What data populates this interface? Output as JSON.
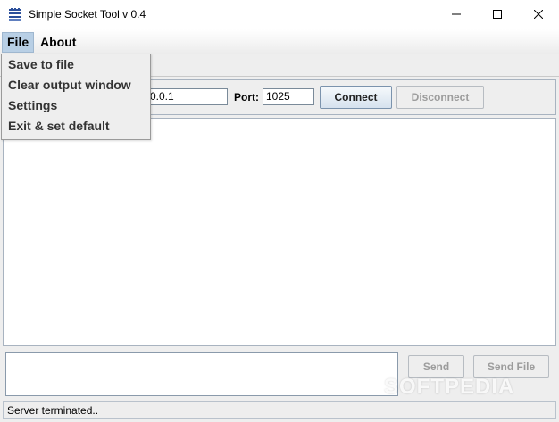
{
  "window": {
    "title": "Simple Socket Tool v 0.4"
  },
  "menubar": {
    "items": [
      {
        "label": "File"
      },
      {
        "label": "About"
      }
    ]
  },
  "file_menu": {
    "items": [
      {
        "label": "Save to file"
      },
      {
        "label": "Clear output window"
      },
      {
        "label": "Settings"
      },
      {
        "label": "Exit & set default"
      }
    ]
  },
  "connection": {
    "host_value": "0.0.1",
    "port_label": "Port:",
    "port_value": "1025",
    "connect_label": "Connect",
    "disconnect_label": "Disconnect"
  },
  "sender": {
    "message_value": "",
    "send_label": "Send",
    "send_file_label": "Send File"
  },
  "status": {
    "text": "Server terminated.."
  },
  "watermark": {
    "text": "SOFTPEDIA"
  },
  "colors": {
    "menu_selected": "#b8cfe5",
    "window_bg": "#eeeeee"
  }
}
